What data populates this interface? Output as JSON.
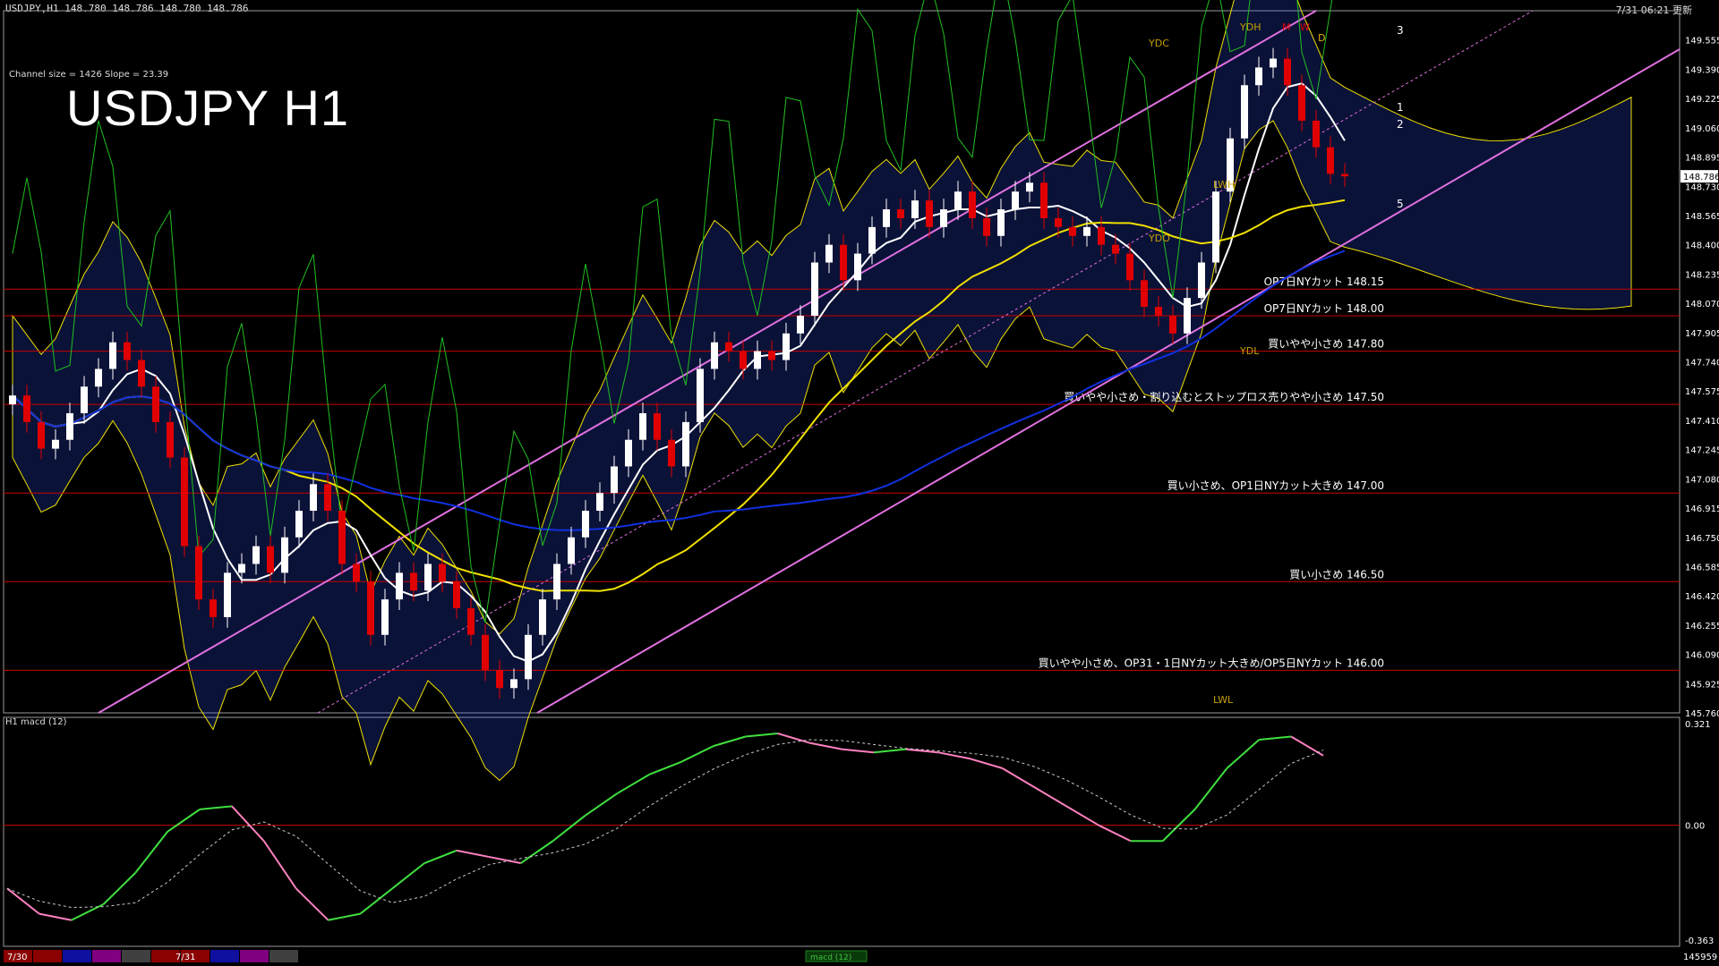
{
  "header": {
    "symbol_line": "USDJPY,H1  148.780 148.786 148.780 148.786",
    "datetime": "7/31 06:21 更新"
  },
  "title": "USDJPY H1",
  "channel_info": "Channel size = 1426 Slope = 23.39",
  "macd_label": "H1  macd (12)",
  "colors": {
    "background": "#000000",
    "bull": "#ffffff",
    "bear": "#e00000",
    "level_line": "#c80000",
    "channel": "#e070e0",
    "ma_fast": "#ffffff",
    "ma_mid": "#f0e000",
    "ma_slow": "#1030e0",
    "chikou": "#20c020",
    "cloud_bull": "#3050ff",
    "cloud_bear": "#ff8050",
    "macd_up": "#40e040",
    "macd_down": "#ff80c0",
    "signal": "#cccccc",
    "axis_text": "#ffffff",
    "pivot_box": "#c8a000"
  },
  "chart_data": [
    {
      "type": "candlestick",
      "pair": "USDJPY",
      "timeframe": "H1",
      "ylim": [
        145.76,
        149.72
      ],
      "y_ticks": [
        "149.555",
        "149.390",
        "149.225",
        "149.060",
        "148.895",
        "148.730",
        "148.565",
        "148.400",
        "148.235",
        "148.070",
        "147.905",
        "147.740",
        "147.575",
        "147.410",
        "147.245",
        "147.080",
        "146.915",
        "146.750",
        "146.585",
        "146.420",
        "146.255",
        "146.090",
        "145.925",
        "145.760"
      ],
      "current_price": "148.786",
      "candles_close": [
        147.55,
        147.4,
        147.25,
        147.3,
        147.45,
        147.6,
        147.7,
        147.85,
        147.75,
        147.6,
        147.4,
        147.2,
        146.7,
        146.4,
        146.3,
        146.55,
        146.6,
        146.7,
        146.55,
        146.75,
        146.9,
        147.05,
        146.9,
        146.6,
        146.5,
        146.2,
        146.4,
        146.55,
        146.45,
        146.6,
        146.5,
        146.35,
        146.2,
        146.0,
        145.9,
        145.95,
        146.2,
        146.4,
        146.6,
        146.75,
        146.9,
        147.0,
        147.15,
        147.3,
        147.45,
        147.3,
        147.15,
        147.4,
        147.7,
        147.85,
        147.8,
        147.7,
        147.8,
        147.75,
        147.9,
        148.0,
        148.3,
        148.4,
        148.2,
        148.35,
        148.5,
        148.6,
        148.55,
        148.65,
        148.5,
        148.6,
        148.7,
        148.55,
        148.45,
        148.6,
        148.7,
        148.75,
        148.55,
        148.5,
        148.45,
        148.5,
        148.4,
        148.35,
        148.2,
        148.05,
        148.0,
        147.9,
        148.1,
        148.3,
        148.7,
        149.0,
        149.3,
        149.4,
        149.45,
        149.3,
        149.1,
        148.95,
        148.8,
        148.786
      ],
      "levels": [
        {
          "label": "OP7日NYカット 148.15",
          "value": 148.15
        },
        {
          "label": "OP7日NYカット 148.00",
          "value": 148.0
        },
        {
          "label": "買いやや小さめ 147.80",
          "value": 147.8
        },
        {
          "label": "買いやや小さめ・割り込むとストップロス売りやや小さめ 147.50",
          "value": 147.5
        },
        {
          "label": "買い小さめ、OP1日NYカット大きめ 147.00",
          "value": 147.0
        },
        {
          "label": "買い小さめ 146.50",
          "value": 146.5
        },
        {
          "label": "買いやや小さめ、OP31・1日NYカット大きめ/OP5日NYカット 146.00",
          "value": 146.0
        }
      ],
      "pivot_labels": [
        "YDH",
        "YDC",
        "YDO",
        "YDL",
        "LWH",
        "LWL",
        "M",
        "W",
        "D",
        "D"
      ],
      "projection_labels": [
        "3",
        "1",
        "2",
        "5"
      ]
    },
    {
      "type": "line",
      "name": "macd",
      "ylim": [
        -0.363,
        0.321
      ],
      "y_ticks": [
        "0.321",
        "0.00",
        "-0.363"
      ],
      "values": [
        -0.2,
        -0.28,
        -0.3,
        -0.25,
        -0.15,
        -0.02,
        0.05,
        0.06,
        -0.05,
        -0.2,
        -0.3,
        -0.28,
        -0.2,
        -0.12,
        -0.08,
        -0.1,
        -0.12,
        -0.05,
        0.03,
        0.1,
        0.16,
        0.2,
        0.25,
        0.28,
        0.29,
        0.26,
        0.24,
        0.23,
        0.24,
        0.23,
        0.21,
        0.18,
        0.12,
        0.06,
        0.0,
        -0.05,
        -0.05,
        0.05,
        0.18,
        0.27,
        0.28,
        0.22
      ]
    }
  ],
  "time_axis": {
    "labels": [
      "7/30",
      "7/31"
    ],
    "last_tick": "145959",
    "scroll_label": "macd (12)"
  }
}
